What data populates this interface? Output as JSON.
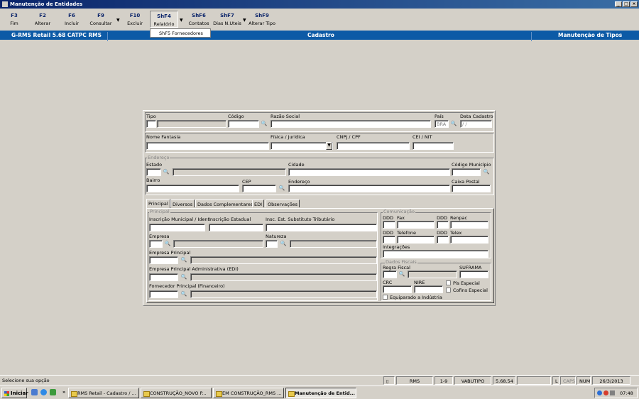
{
  "window": {
    "title": "Manutenção de Entidades"
  },
  "toolbar": {
    "buttons": [
      {
        "key": "F3",
        "label": "Fim"
      },
      {
        "key": "F2",
        "label": "Alterar"
      },
      {
        "key": "F6",
        "label": "Incluir"
      },
      {
        "key": "F9",
        "label": "Consultar"
      },
      {
        "key": "F10",
        "label": "Excluir"
      },
      {
        "key": "ShF4",
        "label": "Relatório"
      },
      {
        "key": "ShF6",
        "label": "Contatos"
      },
      {
        "key": "ShF7",
        "label": "Dias N.Uteis"
      },
      {
        "key": "ShF9",
        "label": "Alterar Tipo"
      }
    ],
    "dropdown_item": "ShF5 Fornecedores"
  },
  "band": {
    "left": "G-RMS Retail 5.68 CATPC RMS",
    "center": "Cadastro",
    "right": "Manutenção de Tipos"
  },
  "header": {
    "tipo": "Tipo",
    "codigo": "Código",
    "razao_social": "Razão Social",
    "pais": "País",
    "pais_value": "BRA",
    "data_cadastro": "Data Cadastro",
    "data_cadastro_value": "/ /",
    "nome_fantasia": "Nome Fantasia",
    "fisica_juridica": "Física / Jurídica",
    "cnpj_cpf": "CNPJ / CPF",
    "cei_nit": "CEI / NIT"
  },
  "endereco": {
    "group": "Endereço",
    "estado": "Estado",
    "cidade": "Cidade",
    "codigo_municipio": "Código Município",
    "bairro": "Bairro",
    "cep": "CEP",
    "endereco": "Endereço",
    "caixa_postal": "Caixa Postal"
  },
  "tabs": [
    "Principal",
    "Diversos",
    "Dados Complementares",
    "EDI",
    "Observações"
  ],
  "principal": {
    "group": "Principal",
    "inscricao_municipal": "Inscrição Municipal / Ident",
    "inscricao_estadual": "Inscrição Estadual",
    "insc_substituto": "Insc. Est. Substituto Tributário",
    "empresa": "Empresa",
    "natureza": "Natureza",
    "empresa_principal": "Empresa Principal",
    "empresa_principal_adm": "Empresa Principal Administrativa (EDI)",
    "fornecedor_principal": "Fornecedor Principal (Financeiro)"
  },
  "comunicacao": {
    "group": "Comunicação",
    "ddd": "DDD",
    "fax": "Fax",
    "renpac": "Renpac",
    "telefone": "Telefone",
    "telex": "Telex",
    "integracoes": "Integrações"
  },
  "fiscais": {
    "group": "Dados Fiscais",
    "regra_fiscal": "Regra Fiscal",
    "suframa": "SUFRAMA",
    "crc": "CRC",
    "nire": "NIRE",
    "pis_especial": "Pis Especial",
    "cofins_especial": "Cofins Especial",
    "equiparado": "Equiparado a Indústria"
  },
  "status": {
    "message": "Selecione sua opção",
    "app": "RMS",
    "page": "1-9",
    "user": "VABUTIPO",
    "version": "5.68.54",
    "l": "L",
    "caps": "CAPS",
    "num": "NUM",
    "date": "26/3/2013"
  },
  "taskbar": {
    "start": "Iniciar",
    "tasks": [
      "RMS Retail - Cadastro / ...",
      "CONSTRUÇÃO_NOVO P...",
      "EM CONSTRUÇÃO_RMS ...",
      "Manutenção de Entid..."
    ],
    "clock": "07:48"
  }
}
